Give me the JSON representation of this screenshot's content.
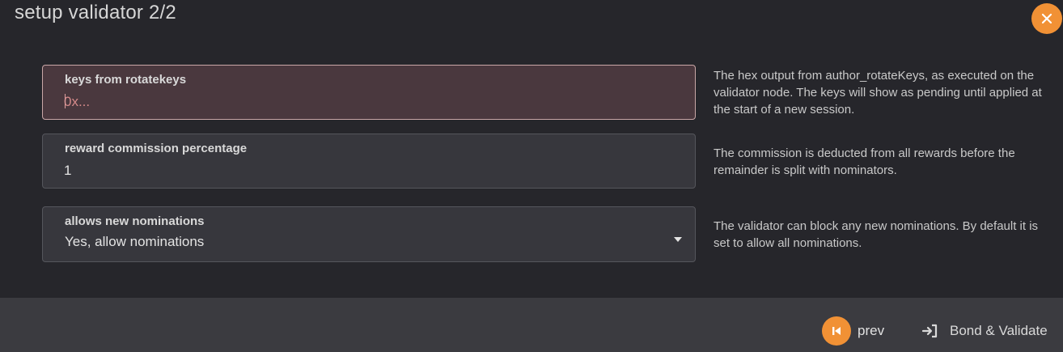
{
  "modal": {
    "title": "setup validator 2/2",
    "close_icon": "close-icon",
    "accent_color": "#f19135"
  },
  "fields": {
    "keys": {
      "label": "keys from rotatekeys",
      "value": "",
      "placeholder": "0x...",
      "help": "The hex output from author_rotateKeys, as executed on the validator node. The keys will show as pending until applied at the start of a new session.",
      "state": "error"
    },
    "commission": {
      "label": "reward commission percentage",
      "value": "1",
      "help": "The commission is deducted from all rewards before the remainder is split with nominators."
    },
    "nominations": {
      "label": "allows new nominations",
      "selected": "Yes, allow nominations",
      "help": "The validator can block any new nominations. By default it is set to allow all nominations."
    }
  },
  "footer": {
    "prev_label": "prev",
    "prev_icon": "step-backward-icon",
    "bond_label": "Bond & Validate",
    "bond_icon": "sign-in-icon"
  }
}
